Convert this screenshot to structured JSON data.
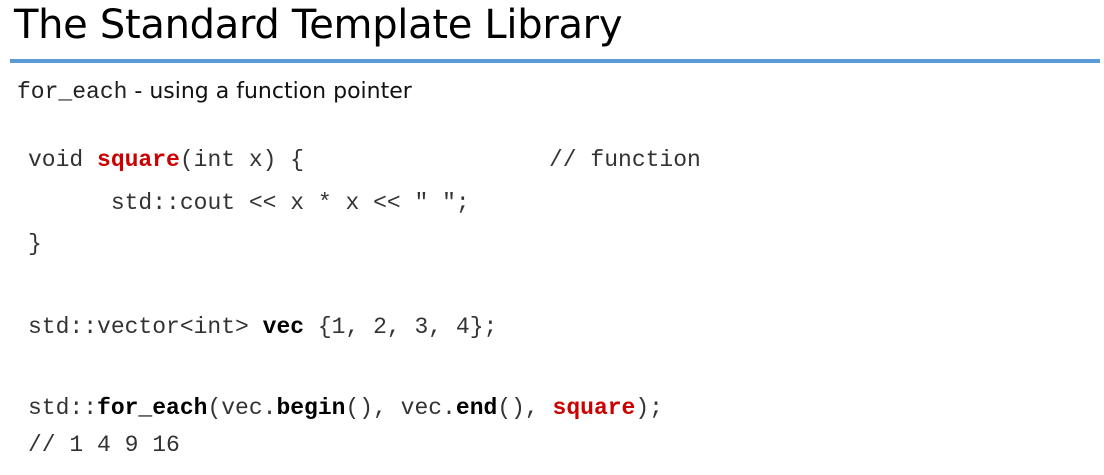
{
  "slide": {
    "title": "The Standard Template Library",
    "subtitle_code": "for_each",
    "subtitle_text": " - using a function pointer"
  },
  "code": {
    "line1": {
      "prefix": "void ",
      "fn_name": "square",
      "suffix": "(int x) {",
      "comment": "// function"
    },
    "line2": {
      "indent": "      ",
      "text": "std::cout << x * x << \" \";"
    },
    "line3": {
      "text": "}"
    },
    "line4": {
      "prefix": "std::vector<int> ",
      "var": "vec",
      "suffix": " {1, 2, 3, 4};"
    },
    "line5": {
      "p1": "std::",
      "algo": "for_each",
      "p2": "(vec.",
      "begin": "begin",
      "p3": "(), vec.",
      "end": "end",
      "p4": "(), ",
      "fn_arg": "square",
      "p5": ");"
    },
    "line6": {
      "text": "// 1 4 9 16"
    }
  }
}
